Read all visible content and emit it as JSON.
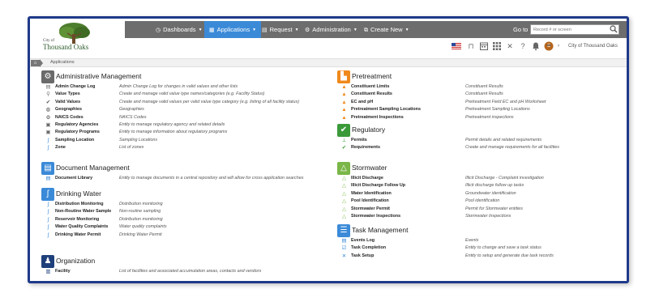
{
  "brand": {
    "logo_small": "City of",
    "logo_text": "Thousand Oaks"
  },
  "nav": {
    "items": [
      {
        "label": "Dashboards",
        "icon": "dashboard-icon"
      },
      {
        "label": "Applications",
        "icon": "grid-icon",
        "active": true
      },
      {
        "label": "Request",
        "icon": "document-icon"
      },
      {
        "label": "Administration",
        "icon": "gears-icon"
      },
      {
        "label": "Create New",
        "icon": "new-icon"
      }
    ],
    "goto_label": "Go to",
    "search_placeholder": "Record # or screen"
  },
  "toolbar": {
    "icons": [
      "us-flag-icon",
      "bookmark-icon",
      "calendar-icon",
      "apps-grid-icon",
      "tools-icon",
      "help-icon",
      "bell-icon",
      "user-avatar"
    ],
    "city_name": "City of Thousand Oaks"
  },
  "breadcrumb": {
    "current": "Applications"
  },
  "colors": {
    "navbar": "#6d6d6d",
    "active_nav": "#3b8ad8",
    "frame_border": "#1f3a8a",
    "admin": "#6a6a6a",
    "document": "#3b8ad8",
    "drinking": "#3b8ad8",
    "organization": "#1e3f7a",
    "pretreatment": "#f0891c",
    "regulatory": "#3a9a3a",
    "stormwater": "#7ab648",
    "task": "#3b8ad8"
  },
  "sections_left": [
    {
      "title": "Administrative Management",
      "icon": "gear-icon",
      "color": "#6a6a6a",
      "items": [
        {
          "name": "Admin Change Log",
          "desc": "Admin Change Log for changes in valid values and other lists",
          "icon": "log-icon"
        },
        {
          "name": "Value Types",
          "desc": "Create and manage valid value type names/categories (e.g. Facility Status)",
          "icon": "tag-icon"
        },
        {
          "name": "Valid Values",
          "desc": "Create and manage valid values per valid value type category (e.g. listing of all facility status)",
          "icon": "check-icon"
        },
        {
          "name": "Geographies",
          "desc": "Geographies",
          "icon": "globe-icon"
        },
        {
          "name": "NAICS Codes",
          "desc": "NAICS Codes",
          "icon": "gear-icon"
        },
        {
          "name": "Regulatory Agencies",
          "desc": "Entity to manage regulatory agency and related details",
          "icon": "agency-icon"
        },
        {
          "name": "Regulatory Programs",
          "desc": "Entity to manage information about regulatory programs",
          "icon": "program-icon"
        },
        {
          "name": "Sampling Location",
          "desc": "Sampling Locations",
          "icon": "pipe-icon"
        },
        {
          "name": "Zone",
          "desc": "List of zones",
          "icon": "pipe-icon"
        }
      ]
    },
    {
      "title": "Document Management",
      "icon": "document-icon",
      "color": "#3b8ad8",
      "items": [
        {
          "name": "Document Library",
          "desc": "Entity to manage documents in a central repository and will allow for cross application searches",
          "icon": "file-icon"
        }
      ]
    },
    {
      "title": "Drinking Water",
      "icon": "faucet-icon",
      "color": "#3b8ad8",
      "items": [
        {
          "name": "Distribution Monitoring",
          "desc": "Distribution monitoring",
          "icon": "pipe-icon"
        },
        {
          "name": "Non-Routine Water Sample",
          "desc": "Non-routine sampling",
          "icon": "pipe-icon"
        },
        {
          "name": "Reservoir Monitoring",
          "desc": "Distribution monitoring",
          "icon": "pipe-icon"
        },
        {
          "name": "Water Quality Complaints",
          "desc": "Water quality complaints",
          "icon": "pipe-icon"
        },
        {
          "name": "Drinking Water Permit",
          "desc": "Drinking Water Permit",
          "icon": "pipe-icon"
        }
      ]
    },
    {
      "title": "Organization",
      "icon": "organization-icon",
      "color": "#1e3f7a",
      "items": [
        {
          "name": "Facility",
          "desc": "List of facilities and associated accumulation areas, contacts and vendors",
          "icon": "building-icon"
        }
      ]
    }
  ],
  "sections_right": [
    {
      "title": "Pretreatment",
      "icon": "factory-icon",
      "color": "#f0891c",
      "items": [
        {
          "name": "Constituent Limits",
          "desc": "Constituent Results",
          "icon": "flask-icon"
        },
        {
          "name": "Constituent Results",
          "desc": "Constituent Results",
          "icon": "flask-icon"
        },
        {
          "name": "EC and pH",
          "desc": "Pretreatment Field EC and pH Worksheet",
          "icon": "flask-icon"
        },
        {
          "name": "Pretreatment Sampling Locations",
          "desc": "Pretreatment Sampling Locations",
          "icon": "flask-icon"
        },
        {
          "name": "Pretreatment Inspections",
          "desc": "Pretreatment inspections",
          "icon": "flask-icon"
        }
      ]
    },
    {
      "title": "Regulatory",
      "icon": "checkmark-icon",
      "color": "#3a9a3a",
      "items": [
        {
          "name": "Permits",
          "desc": "Permit details and related requirements",
          "icon": "stamp-icon"
        },
        {
          "name": "Requirements",
          "desc": "Create and manage requirements for all facilities",
          "icon": "check-icon"
        }
      ]
    },
    {
      "title": "Stormwater",
      "icon": "stormwater-icon",
      "color": "#7ab648",
      "items": [
        {
          "name": "Illicit Discharge",
          "desc": "Illicit Discharge - Complaint investigation",
          "icon": "warning-icon"
        },
        {
          "name": "Illicit Discharge Follow Up",
          "desc": "Illicit discharge follow up tasks",
          "icon": "warning-icon"
        },
        {
          "name": "Water Identification",
          "desc": "Groundwater identification",
          "icon": "warning-icon"
        },
        {
          "name": "Pool Identification",
          "desc": "Pool identification",
          "icon": "warning-icon"
        },
        {
          "name": "Stormwater Permit",
          "desc": "Permit for Stormwater entities",
          "icon": "warning-icon"
        },
        {
          "name": "Stormwater Inspections",
          "desc": "Stormwater Inspections",
          "icon": "warning-icon"
        }
      ]
    },
    {
      "title": "Task Management",
      "icon": "tasks-icon",
      "color": "#3b8ad8",
      "items": [
        {
          "name": "Events Log",
          "desc": "Events",
          "icon": "event-icon"
        },
        {
          "name": "Task Completion",
          "desc": "Entity to change and save a task status",
          "icon": "task-icon"
        },
        {
          "name": "Task Setup",
          "desc": "Entity to setup and generate due task records",
          "icon": "wrench-icon"
        }
      ]
    }
  ]
}
